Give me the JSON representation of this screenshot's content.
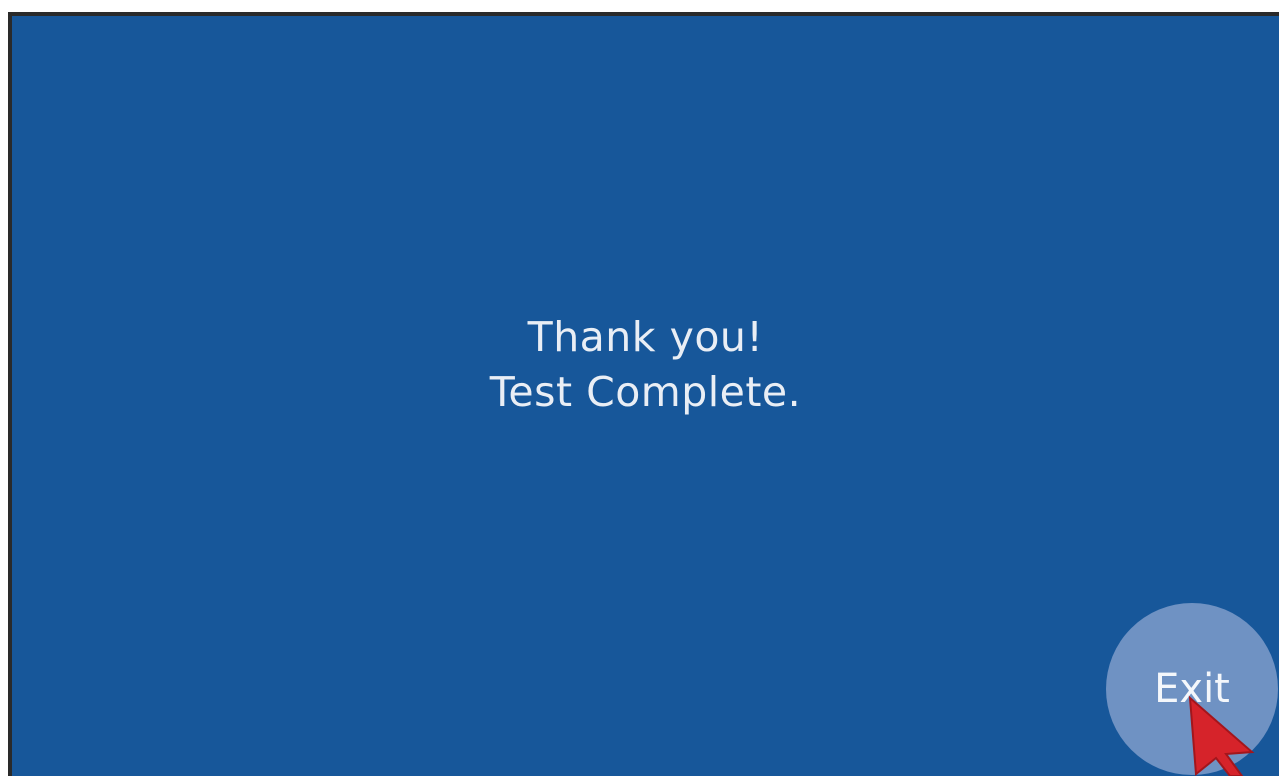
{
  "message": {
    "line1": "Thank you!",
    "line2": "Test Complete."
  },
  "exit_button": {
    "label": "Exit"
  },
  "colors": {
    "background": "#17579a",
    "exit_button": "#6f92c3",
    "text": "#e9eef5",
    "cursor": "#d6232a"
  },
  "icons": {
    "cursor": "mouse-pointer-icon"
  }
}
